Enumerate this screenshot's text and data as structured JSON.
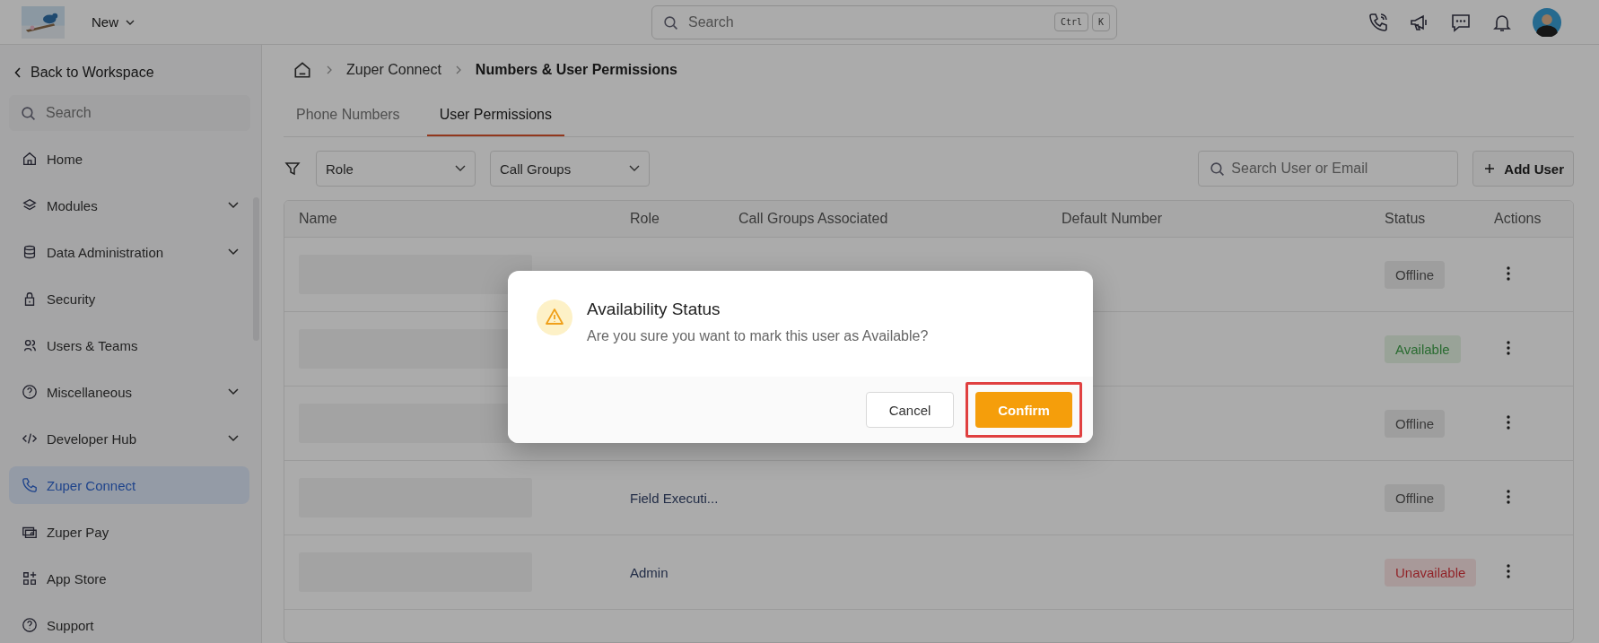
{
  "topbar": {
    "menu_label": "New",
    "search": {
      "placeholder": "Search",
      "keys": [
        "Ctrl",
        "K"
      ]
    }
  },
  "sidebar": {
    "back": "Back to Workspace",
    "search_placeholder": "Search",
    "items": [
      {
        "label": "Home",
        "expandable": false,
        "selected": false
      },
      {
        "label": "Modules",
        "expandable": true,
        "selected": false
      },
      {
        "label": "Data Administration",
        "expandable": true,
        "selected": false
      },
      {
        "label": "Security",
        "expandable": false,
        "selected": false
      },
      {
        "label": "Users & Teams",
        "expandable": false,
        "selected": false
      },
      {
        "label": "Miscellaneous",
        "expandable": true,
        "selected": false
      },
      {
        "label": "Developer Hub",
        "expandable": true,
        "selected": false
      },
      {
        "label": "Zuper Connect",
        "expandable": false,
        "selected": true
      },
      {
        "label": "Zuper Pay",
        "expandable": false,
        "selected": false
      },
      {
        "label": "App Store",
        "expandable": false,
        "selected": false
      },
      {
        "label": "Support",
        "expandable": false,
        "selected": false
      }
    ]
  },
  "breadcrumb": [
    "Zuper Connect",
    "Numbers & User Permissions"
  ],
  "tabs": [
    {
      "label": "Phone Numbers",
      "selected": false
    },
    {
      "label": "User Permissions",
      "selected": true
    }
  ],
  "filters": [
    "Role",
    "Call Groups"
  ],
  "user_search": {
    "placeholder": "Search User or Email"
  },
  "add_button": "Add User",
  "table": {
    "columns": [
      "Name",
      "Role",
      "Call Groups Associated",
      "Default Number",
      "Status",
      "Actions"
    ],
    "rows": [
      {
        "status": "Offline",
        "kind": "offline"
      },
      {
        "status": "Available",
        "kind": "available"
      },
      {
        "status": "Offline",
        "kind": "offline"
      },
      {
        "role": "Field Executi...",
        "status": "Offline",
        "kind": "offline"
      },
      {
        "role": "Admin",
        "status": "Unavailable",
        "kind": "unavailable"
      }
    ]
  },
  "dialog": {
    "title": "Availability Status",
    "message": "Are you sure you want to mark this user as Available?",
    "buttons": [
      {
        "label": "Cancel",
        "kind": "secondary",
        "highlighted": false
      },
      {
        "label": "Confirm",
        "kind": "primary",
        "highlighted": true
      }
    ]
  }
}
